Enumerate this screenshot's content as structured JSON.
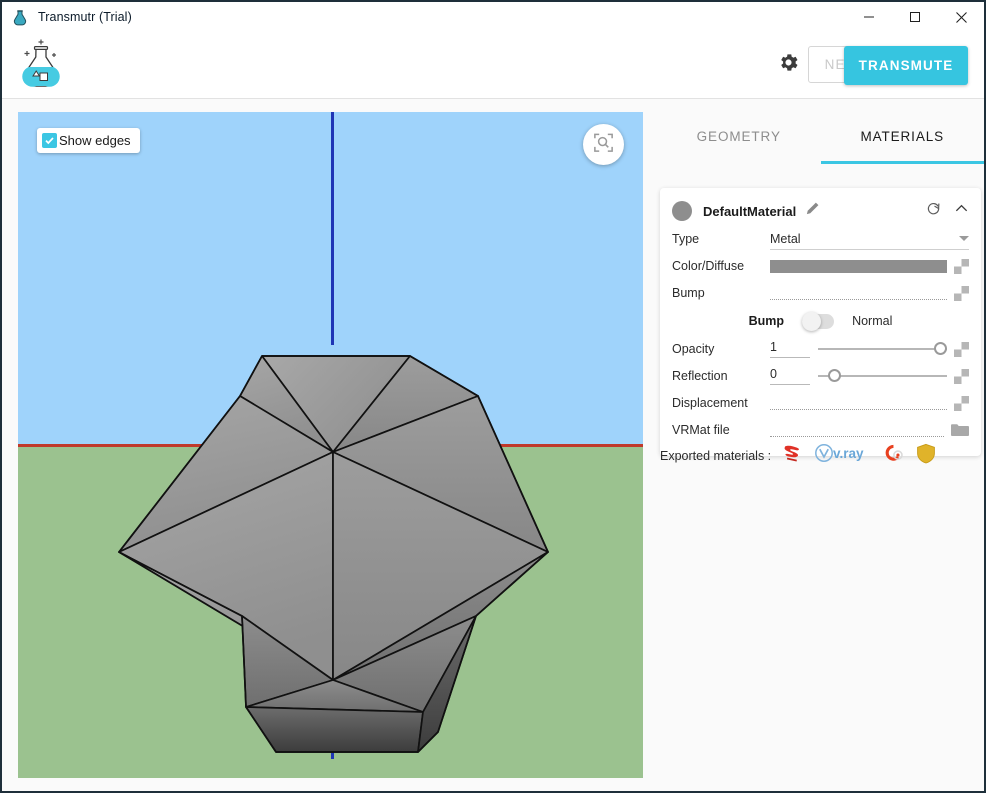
{
  "window": {
    "title": "Transmutr (Trial)",
    "app_icon": "flask-icon",
    "minimize_label": "—",
    "maximize_label": "□",
    "close_label": "✕"
  },
  "toolbar": {
    "logo_icon": "transmutr-flask-logo",
    "settings_icon": "gear-icon",
    "new_label": "NEW",
    "transmute_label": "TRANSMUTE",
    "accent_color": "#36c5e0"
  },
  "viewport": {
    "show_edges_label": "Show edges",
    "show_edges_checked": true,
    "zoom_extents_icon": "zoom-extents-icon",
    "sky_color": "#9fd3fb",
    "ground_color": "#9bc28f",
    "axis_red_color": "#c0392b",
    "axis_blue_color": "#1f35b5",
    "model_name": "low-poly-sphere"
  },
  "panel": {
    "tabs": [
      {
        "label": "GEOMETRY",
        "active": false
      },
      {
        "label": "MATERIALS",
        "active": true
      }
    ],
    "material": {
      "name": "DefaultMaterial",
      "swatch_color": "#8e8e8e",
      "edit_icon": "pencil-icon",
      "reset_icon": "reset-icon",
      "collapse_icon": "chevron-up-icon",
      "rows": {
        "type": {
          "label": "Type",
          "value": "Metal"
        },
        "color_diffuse": {
          "label": "Color/Diffuse",
          "value": "#8e8e8e",
          "texture_icon": "texture-icon"
        },
        "bump": {
          "label": "Bump",
          "value": "",
          "texture_icon": "texture-icon"
        },
        "bump_toggle": {
          "left_label": "Bump",
          "right_label": "Normal",
          "state": "bump"
        },
        "opacity": {
          "label": "Opacity",
          "value": "1",
          "slider_pct": 100,
          "texture_icon": "texture-icon"
        },
        "reflection": {
          "label": "Reflection",
          "value": "0",
          "slider_pct": 8,
          "texture_icon": "texture-icon"
        },
        "displacement": {
          "label": "Displacement",
          "value": "",
          "texture_icon": "texture-icon"
        },
        "vrmat_file": {
          "label": "VRMat file",
          "value": "",
          "folder_icon": "folder-icon"
        }
      }
    },
    "exported": {
      "label": "Exported materials :",
      "icons": [
        {
          "name": "sketchup-icon",
          "color": "#e03127"
        },
        {
          "name": "vray-icon",
          "color": "#6aa7d8"
        },
        {
          "name": "corona-icon",
          "color": "#e8401f"
        },
        {
          "name": "thea-shield-icon",
          "color": "#e0b32a"
        }
      ]
    }
  }
}
